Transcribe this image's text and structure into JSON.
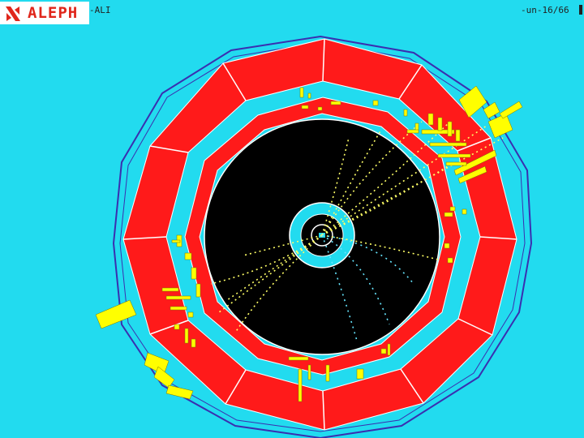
{
  "header": {
    "logo_text": "ALEPH",
    "run_label": "-ALI",
    "date_label": "-un-16/66"
  },
  "icons": {
    "logo": "aleph-logo-icon"
  },
  "colors": {
    "background": "#22dbef",
    "calorimeter": "#ff1a1a",
    "tracking_chamber": "#000000",
    "energy_deposits": "#ffff00",
    "tracks": "#ffff66",
    "outline": "#3a2fb0"
  }
}
